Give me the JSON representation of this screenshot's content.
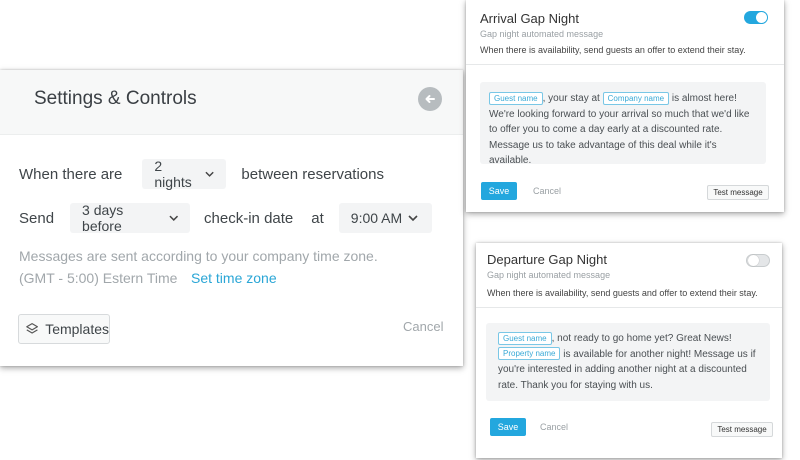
{
  "settings": {
    "title": "Settings & Controls",
    "row1": {
      "prefix": "When there are",
      "nights": "2 nights",
      "suffix": "between reservations"
    },
    "row2": {
      "prefix": "Send",
      "days": "3 days before",
      "middle": "check-in date",
      "at": "at",
      "time": "9:00 AM"
    },
    "note1": "Messages are sent according to your company time zone.",
    "timezone": "(GMT - 5:00) Estern Time",
    "set_timezone": "Set time zone",
    "templates_label": "Templates",
    "cancel_label": "Cancel"
  },
  "arrival": {
    "title": "Arrival Gap Night",
    "subtitle": "Gap night automated message",
    "description": "When there is availability, send guests an offer to extend their stay.",
    "enabled": true,
    "tag_guest": "Guest name",
    "text1": ", your stay at",
    "tag_company": "Company name",
    "text2": "is almost here! We're looking forward to your arrival so much that we'd like to offer you to come a day early at a discounted rate. Message us to take advantage of this deal while it's  available.",
    "save_label": "Save",
    "cancel_label": "Cancel",
    "test_label": "Test message"
  },
  "departure": {
    "title": "Departure Gap Night",
    "subtitle": "Gap night automated message",
    "description": "When there is availability, send guests and offer to extend their stay.",
    "enabled": false,
    "tag_guest": "Guest name",
    "text1": ", not ready to go home yet? Great News!",
    "tag_property": "Property name",
    "text2": "is available for another night! Message us if you're interested in adding another night at a discounted rate. Thank you for staying with us.",
    "save_label": "Save",
    "cancel_label": "Cancel",
    "test_label": "Test message"
  },
  "colors": {
    "accent": "#23a7de",
    "tag_border": "#79c7e6",
    "muted": "#a1a7ab"
  },
  "icons": [
    "back-arrow-icon",
    "chevron-down-icon",
    "layers-icon",
    "toggle-switch"
  ]
}
